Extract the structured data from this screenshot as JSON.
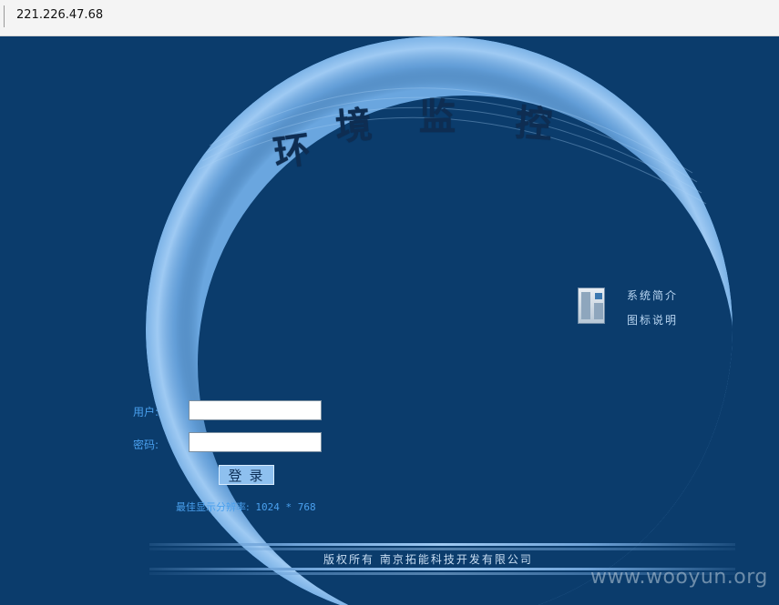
{
  "browser": {
    "address": "221.226.47.68"
  },
  "header": {
    "title_chars": [
      "环",
      "境",
      "监",
      "控"
    ]
  },
  "side_links": [
    {
      "label": "系统简介"
    },
    {
      "label": "图标说明"
    }
  ],
  "login": {
    "username_label": "用户:",
    "password_label": "密码:",
    "username_value": "",
    "password_value": "",
    "submit_label": "登录"
  },
  "resolution": {
    "prefix": "最佳显示分辨率:",
    "value": " 1024 * 768"
  },
  "footer": {
    "copyright": "版权所有   南京拓能科技开发有限公司"
  },
  "watermark": {
    "text": "www.wooyun.org"
  },
  "colors": {
    "background": "#0b3c6c",
    "crescent": "#7fb5e8",
    "label_blue": "#4aa0ee",
    "title": "#0e2d52"
  }
}
